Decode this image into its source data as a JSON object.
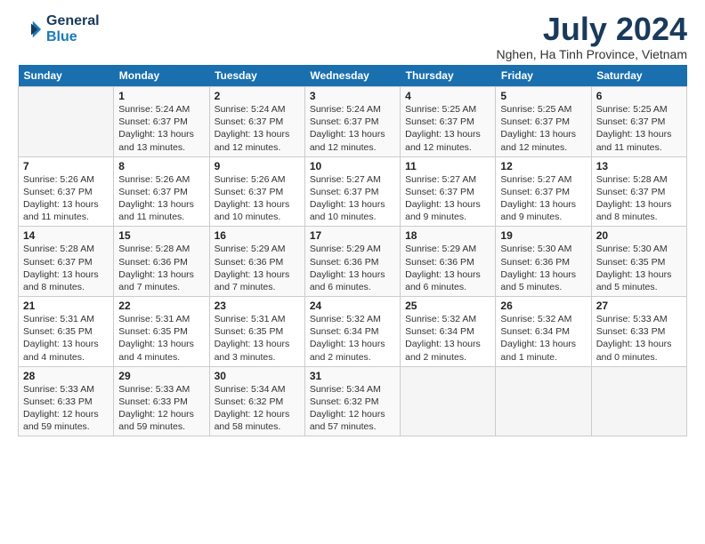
{
  "logo": {
    "line1": "General",
    "line2": "Blue"
  },
  "title": "July 2024",
  "subtitle": "Nghen, Ha Tinh Province, Vietnam",
  "weekdays": [
    "Sunday",
    "Monday",
    "Tuesday",
    "Wednesday",
    "Thursday",
    "Friday",
    "Saturday"
  ],
  "weeks": [
    [
      {
        "day": "",
        "sunrise": "",
        "sunset": "",
        "daylight": ""
      },
      {
        "day": "1",
        "sunrise": "Sunrise: 5:24 AM",
        "sunset": "Sunset: 6:37 PM",
        "daylight": "Daylight: 13 hours and 13 minutes."
      },
      {
        "day": "2",
        "sunrise": "Sunrise: 5:24 AM",
        "sunset": "Sunset: 6:37 PM",
        "daylight": "Daylight: 13 hours and 12 minutes."
      },
      {
        "day": "3",
        "sunrise": "Sunrise: 5:24 AM",
        "sunset": "Sunset: 6:37 PM",
        "daylight": "Daylight: 13 hours and 12 minutes."
      },
      {
        "day": "4",
        "sunrise": "Sunrise: 5:25 AM",
        "sunset": "Sunset: 6:37 PM",
        "daylight": "Daylight: 13 hours and 12 minutes."
      },
      {
        "day": "5",
        "sunrise": "Sunrise: 5:25 AM",
        "sunset": "Sunset: 6:37 PM",
        "daylight": "Daylight: 13 hours and 12 minutes."
      },
      {
        "day": "6",
        "sunrise": "Sunrise: 5:25 AM",
        "sunset": "Sunset: 6:37 PM",
        "daylight": "Daylight: 13 hours and 11 minutes."
      }
    ],
    [
      {
        "day": "7",
        "sunrise": "Sunrise: 5:26 AM",
        "sunset": "Sunset: 6:37 PM",
        "daylight": "Daylight: 13 hours and 11 minutes."
      },
      {
        "day": "8",
        "sunrise": "Sunrise: 5:26 AM",
        "sunset": "Sunset: 6:37 PM",
        "daylight": "Daylight: 13 hours and 11 minutes."
      },
      {
        "day": "9",
        "sunrise": "Sunrise: 5:26 AM",
        "sunset": "Sunset: 6:37 PM",
        "daylight": "Daylight: 13 hours and 10 minutes."
      },
      {
        "day": "10",
        "sunrise": "Sunrise: 5:27 AM",
        "sunset": "Sunset: 6:37 PM",
        "daylight": "Daylight: 13 hours and 10 minutes."
      },
      {
        "day": "11",
        "sunrise": "Sunrise: 5:27 AM",
        "sunset": "Sunset: 6:37 PM",
        "daylight": "Daylight: 13 hours and 9 minutes."
      },
      {
        "day": "12",
        "sunrise": "Sunrise: 5:27 AM",
        "sunset": "Sunset: 6:37 PM",
        "daylight": "Daylight: 13 hours and 9 minutes."
      },
      {
        "day": "13",
        "sunrise": "Sunrise: 5:28 AM",
        "sunset": "Sunset: 6:37 PM",
        "daylight": "Daylight: 13 hours and 8 minutes."
      }
    ],
    [
      {
        "day": "14",
        "sunrise": "Sunrise: 5:28 AM",
        "sunset": "Sunset: 6:37 PM",
        "daylight": "Daylight: 13 hours and 8 minutes."
      },
      {
        "day": "15",
        "sunrise": "Sunrise: 5:28 AM",
        "sunset": "Sunset: 6:36 PM",
        "daylight": "Daylight: 13 hours and 7 minutes."
      },
      {
        "day": "16",
        "sunrise": "Sunrise: 5:29 AM",
        "sunset": "Sunset: 6:36 PM",
        "daylight": "Daylight: 13 hours and 7 minutes."
      },
      {
        "day": "17",
        "sunrise": "Sunrise: 5:29 AM",
        "sunset": "Sunset: 6:36 PM",
        "daylight": "Daylight: 13 hours and 6 minutes."
      },
      {
        "day": "18",
        "sunrise": "Sunrise: 5:29 AM",
        "sunset": "Sunset: 6:36 PM",
        "daylight": "Daylight: 13 hours and 6 minutes."
      },
      {
        "day": "19",
        "sunrise": "Sunrise: 5:30 AM",
        "sunset": "Sunset: 6:36 PM",
        "daylight": "Daylight: 13 hours and 5 minutes."
      },
      {
        "day": "20",
        "sunrise": "Sunrise: 5:30 AM",
        "sunset": "Sunset: 6:35 PM",
        "daylight": "Daylight: 13 hours and 5 minutes."
      }
    ],
    [
      {
        "day": "21",
        "sunrise": "Sunrise: 5:31 AM",
        "sunset": "Sunset: 6:35 PM",
        "daylight": "Daylight: 13 hours and 4 minutes."
      },
      {
        "day": "22",
        "sunrise": "Sunrise: 5:31 AM",
        "sunset": "Sunset: 6:35 PM",
        "daylight": "Daylight: 13 hours and 4 minutes."
      },
      {
        "day": "23",
        "sunrise": "Sunrise: 5:31 AM",
        "sunset": "Sunset: 6:35 PM",
        "daylight": "Daylight: 13 hours and 3 minutes."
      },
      {
        "day": "24",
        "sunrise": "Sunrise: 5:32 AM",
        "sunset": "Sunset: 6:34 PM",
        "daylight": "Daylight: 13 hours and 2 minutes."
      },
      {
        "day": "25",
        "sunrise": "Sunrise: 5:32 AM",
        "sunset": "Sunset: 6:34 PM",
        "daylight": "Daylight: 13 hours and 2 minutes."
      },
      {
        "day": "26",
        "sunrise": "Sunrise: 5:32 AM",
        "sunset": "Sunset: 6:34 PM",
        "daylight": "Daylight: 13 hours and 1 minute."
      },
      {
        "day": "27",
        "sunrise": "Sunrise: 5:33 AM",
        "sunset": "Sunset: 6:33 PM",
        "daylight": "Daylight: 13 hours and 0 minutes."
      }
    ],
    [
      {
        "day": "28",
        "sunrise": "Sunrise: 5:33 AM",
        "sunset": "Sunset: 6:33 PM",
        "daylight": "Daylight: 12 hours and 59 minutes."
      },
      {
        "day": "29",
        "sunrise": "Sunrise: 5:33 AM",
        "sunset": "Sunset: 6:33 PM",
        "daylight": "Daylight: 12 hours and 59 minutes."
      },
      {
        "day": "30",
        "sunrise": "Sunrise: 5:34 AM",
        "sunset": "Sunset: 6:32 PM",
        "daylight": "Daylight: 12 hours and 58 minutes."
      },
      {
        "day": "31",
        "sunrise": "Sunrise: 5:34 AM",
        "sunset": "Sunset: 6:32 PM",
        "daylight": "Daylight: 12 hours and 57 minutes."
      },
      {
        "day": "",
        "sunrise": "",
        "sunset": "",
        "daylight": ""
      },
      {
        "day": "",
        "sunrise": "",
        "sunset": "",
        "daylight": ""
      },
      {
        "day": "",
        "sunrise": "",
        "sunset": "",
        "daylight": ""
      }
    ]
  ]
}
